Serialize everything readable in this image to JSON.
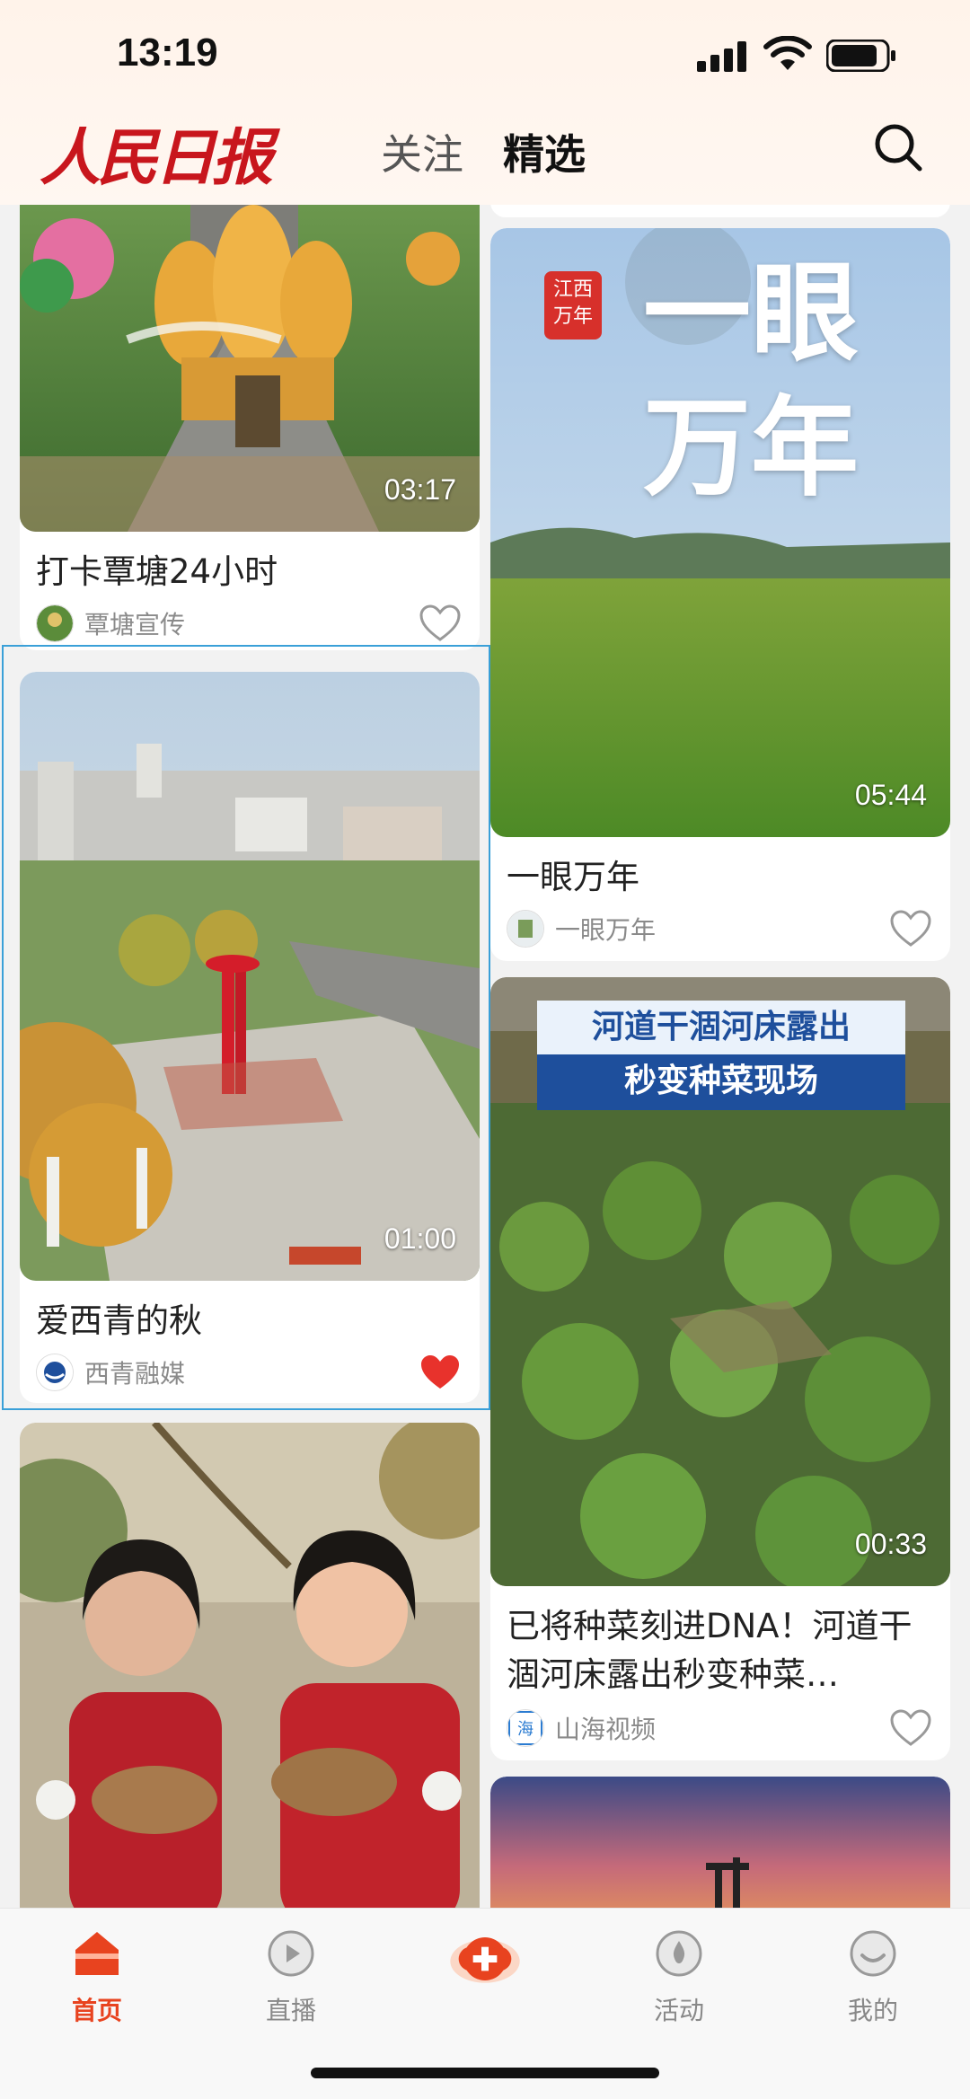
{
  "status": {
    "time": "13:19"
  },
  "header": {
    "logo": "人民日报",
    "tabs": [
      {
        "label": "关注"
      },
      {
        "label": "精选"
      }
    ],
    "active_tab": "精选"
  },
  "feed": {
    "left": [
      {
        "title": "打卡覃塘24小时",
        "duration": "03:17",
        "source": "覃塘宣传",
        "liked": false
      },
      {
        "title": "爱西青的秋",
        "duration": "01:00",
        "source": "西青融媒",
        "liked": true
      },
      {
        "title": "",
        "duration": "",
        "source": "",
        "liked": false
      }
    ],
    "right": [
      {
        "title": "一眼万年",
        "duration": "05:44",
        "source": "一眼万年",
        "liked": false,
        "overlay_text": "一眼万年",
        "badge_text": "江西万年"
      },
      {
        "title": "已将种菜刻进DNA！河道干涸河床露出秒变种菜…",
        "duration": "00:33",
        "source": "山海视频",
        "liked": false,
        "banner_line1": "河道干涸河床露出",
        "banner_line2": "秒变种菜现场"
      },
      {
        "title": "",
        "duration": "",
        "source": "",
        "liked": false
      }
    ]
  },
  "nav": {
    "items": [
      {
        "label": "首页",
        "icon": "home-icon",
        "active": true
      },
      {
        "label": "直播",
        "icon": "live-icon",
        "active": false
      },
      {
        "label": "",
        "icon": "create-plus-icon",
        "active": false
      },
      {
        "label": "活动",
        "icon": "activity-icon",
        "active": false
      },
      {
        "label": "我的",
        "icon": "profile-icon",
        "active": false
      }
    ]
  },
  "colors": {
    "accent": "#e8431f",
    "logo": "#c8161d",
    "like": "#e8322c",
    "selection": "#3aa0d8"
  }
}
